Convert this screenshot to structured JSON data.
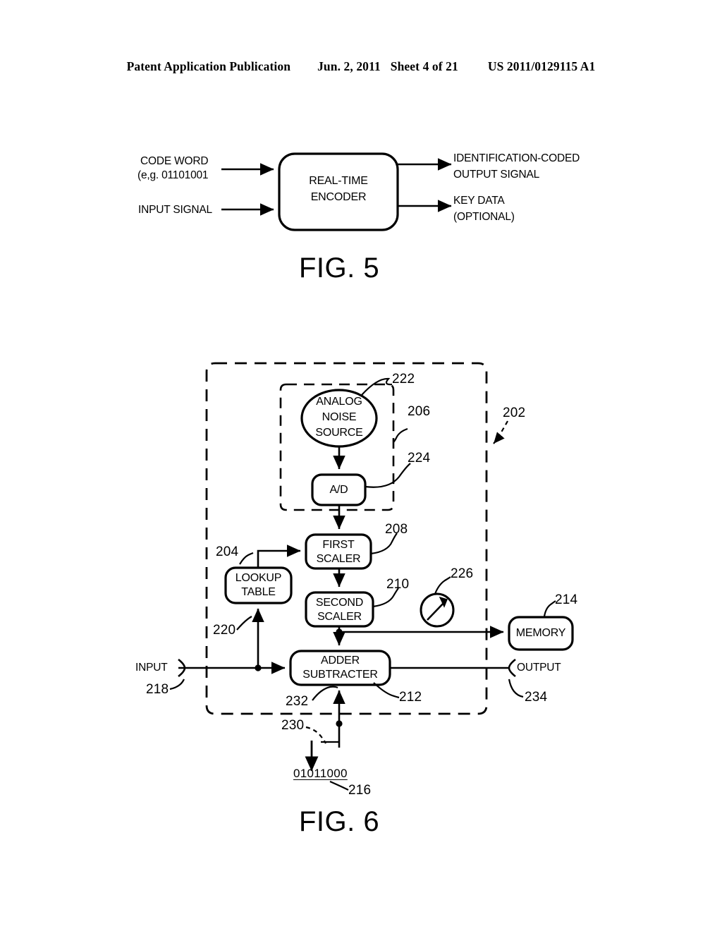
{
  "header": {
    "publication": "Patent Application Publication",
    "date": "Jun. 2, 2011",
    "sheet": "Sheet 4 of 21",
    "number": "US 2011/0129115 A1"
  },
  "figure5": {
    "caption": "FIG. 5",
    "block_label_line1": "REAL-TIME",
    "block_label_line2": "ENCODER",
    "inputs": [
      {
        "line1": "CODE WORD",
        "line2": "(e,g. 01101001"
      },
      {
        "line1": "INPUT SIGNAL",
        "line2": ""
      }
    ],
    "outputs": [
      {
        "line1": "IDENTIFICATION-CODED",
        "line2": "OUTPUT SIGNAL"
      },
      {
        "line1": "KEY DATA",
        "line2": "(OPTIONAL)"
      }
    ]
  },
  "figure6": {
    "caption": "FIG. 6",
    "blocks": {
      "noise_source_line1": "ANALOG",
      "noise_source_line2": "NOISE",
      "noise_source_line3": "SOURCE",
      "ad": "A/D",
      "first_scaler_line1": "FIRST",
      "first_scaler_line2": "SCALER",
      "second_scaler_line1": "SECOND",
      "second_scaler_line2": "SCALER",
      "lookup_table_line1": "LOOKUP",
      "lookup_table_line2": "TABLE",
      "adder_line1": "ADDER",
      "adder_line2": "SUBTRACTER",
      "memory": "MEMORY"
    },
    "ports": {
      "input": "INPUT",
      "output": "OUTPUT"
    },
    "code_word": "01011000",
    "refs": {
      "r202": "202",
      "r204": "204",
      "r206": "206",
      "r208": "208",
      "r210": "210",
      "r212": "212",
      "r214": "214",
      "r216": "216",
      "r218": "218",
      "r220": "220",
      "r222": "222",
      "r224": "224",
      "r226": "226",
      "r230": "230",
      "r232": "232",
      "r234": "234"
    }
  },
  "style": {
    "ink": "#000000",
    "paper": "#ffffff"
  }
}
